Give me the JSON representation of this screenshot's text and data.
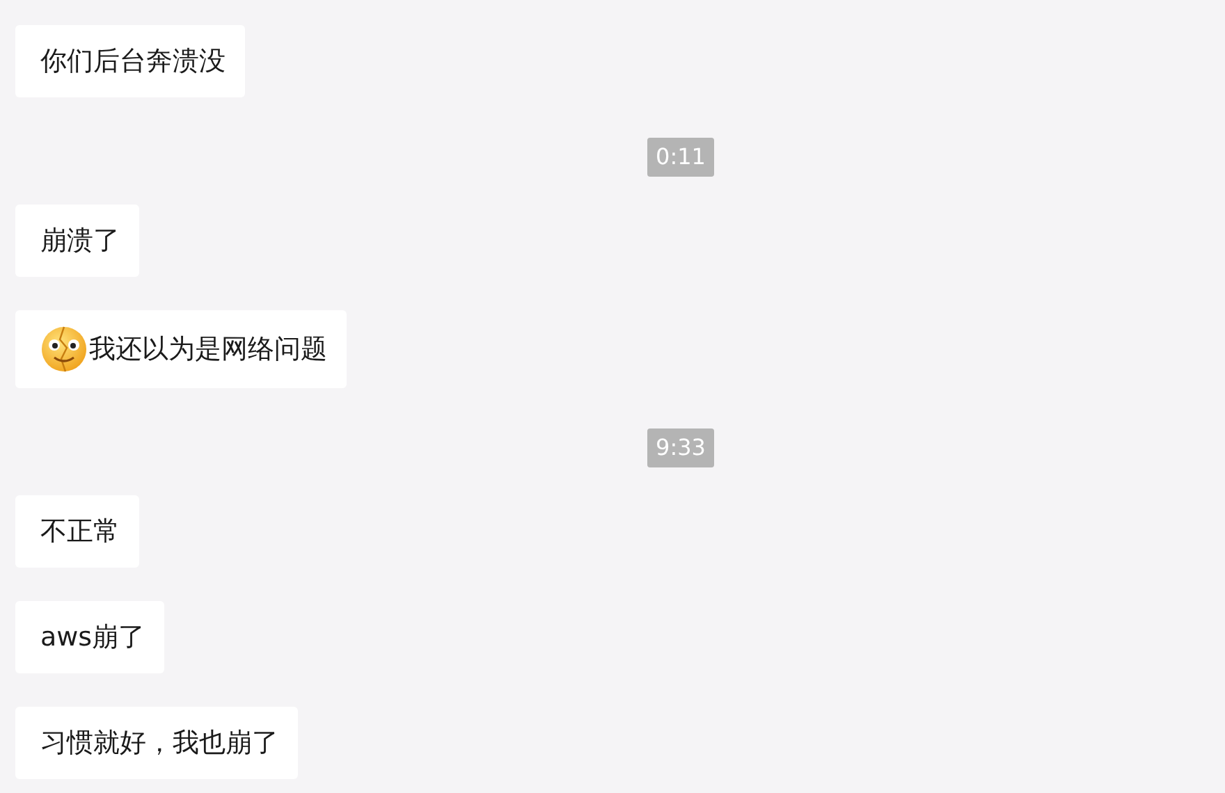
{
  "messages": [
    {
      "kind": "text",
      "text": "你们后台奔溃没",
      "emoji": false
    },
    {
      "kind": "time",
      "text": "0:11"
    },
    {
      "kind": "text",
      "text": "崩溃了",
      "emoji": false
    },
    {
      "kind": "text",
      "text": "我还以为是网络问题",
      "emoji": true
    },
    {
      "kind": "time",
      "text": "9:33"
    },
    {
      "kind": "text",
      "text": "不正常",
      "emoji": false
    },
    {
      "kind": "text",
      "text": "aws崩了",
      "emoji": false
    },
    {
      "kind": "text",
      "text": "习惯就好，我也崩了",
      "emoji": false
    }
  ]
}
